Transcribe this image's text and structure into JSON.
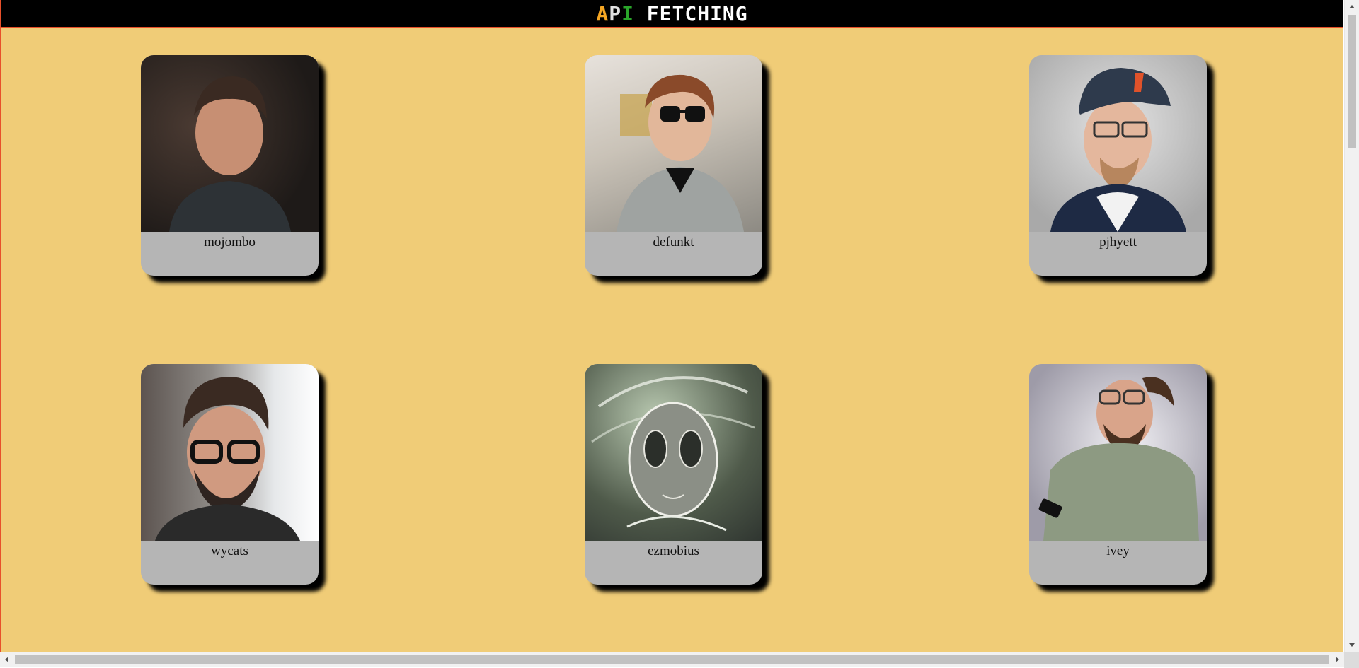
{
  "header": {
    "title_a": "A",
    "title_p": "P",
    "title_i": "I",
    "title_rest": " FETCHING",
    "colors": {
      "a": "#f5a623",
      "p": "#e0e0e0",
      "i": "#2aa52a",
      "rest": "#ffffff",
      "bar": "#000000"
    }
  },
  "page": {
    "background": "#f0cc77"
  },
  "users": [
    {
      "login": "mojombo"
    },
    {
      "login": "defunkt"
    },
    {
      "login": "pjhyett"
    },
    {
      "login": "wycats"
    },
    {
      "login": "ezmobius"
    },
    {
      "login": "ivey"
    }
  ]
}
